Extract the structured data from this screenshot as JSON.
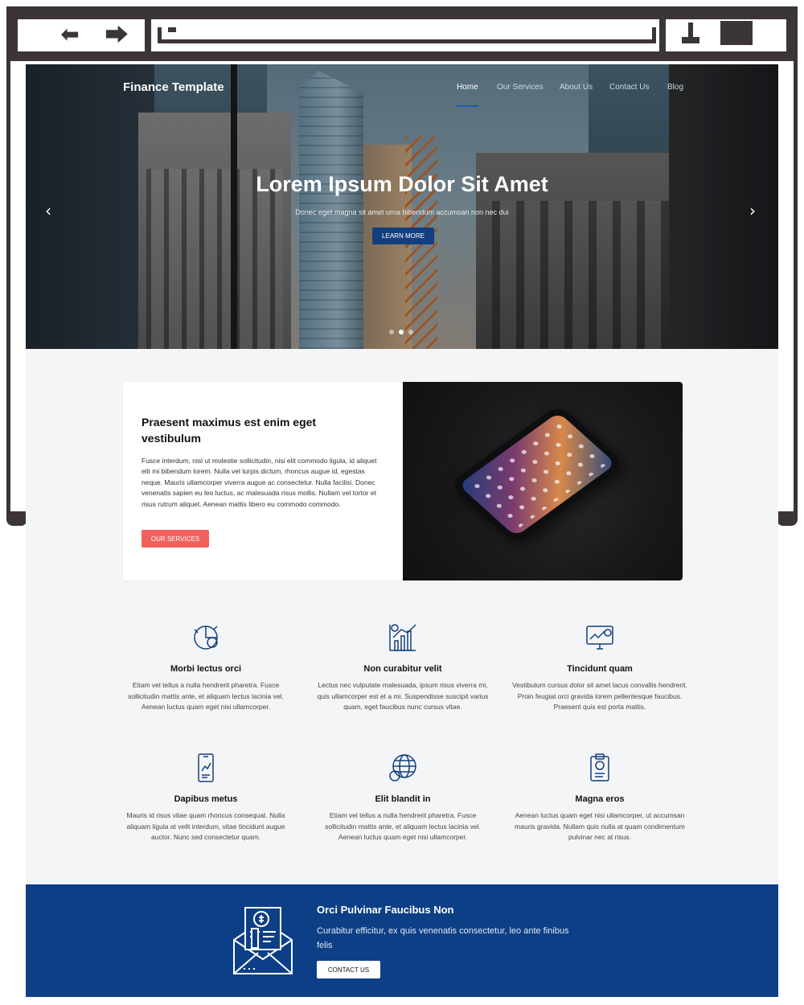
{
  "site": {
    "brand": "Finance Template",
    "nav": [
      {
        "label": "Home",
        "active": true
      },
      {
        "label": "Our Services",
        "active": false
      },
      {
        "label": "About Us",
        "active": false
      },
      {
        "label": "Contact Us",
        "active": false
      },
      {
        "label": "Blog",
        "active": false
      }
    ]
  },
  "hero": {
    "title": "Lorem Ipsum Dolor Sit Amet",
    "subtitle": "Donec eget magna sit amet urna bibendum accumsan non nec dui",
    "button": "LEARN MORE",
    "prev_icon": "chevron-left-icon",
    "next_icon": "chevron-right-icon",
    "slides": 3,
    "active_slide": 1
  },
  "about": {
    "title": "Praesent maximus est enim eget vestibulum",
    "text": "Fusce interdum, nisl ut molestie sollicitudin, nisi elit commodo ligula, id aliquet elit mi bibendum lorem. Nulla vel turpis dictum, rhoncus augue id, egestas neque. Mauris ullamcorper viverra augue ac consectetur. Nulla facilisi. Donec venenatis sapien eu leo luctus, ac malesuada risus mollis. Nullam vel tortor et risus rutrum aliquet. Aenean mattis libero eu commodo commodo.",
    "button": "OUR SERVICES"
  },
  "features": [
    {
      "icon": "pie-chart-dollar-icon",
      "title": "Morbi lectus orci",
      "text": "Etiam vel tellus a nulla hendrerit pharetra. Fusce sollicitudin mattis ante, et aliquam lectus lacinia vel. Aenean luctus quam eget nisi ullamcorper."
    },
    {
      "icon": "growth-chart-icon",
      "title": "Non curabitur velit",
      "text": "Lectus nec vulputate malesuada, ipsum risus viverra mi, quis ullamcorper est et a mi. Suspendisse suscipit varius quam, eget faucibus nunc cursus vitae."
    },
    {
      "icon": "monitor-analytics-icon",
      "title": "Tincidunt quam",
      "text": "Vestibulum cursus dolor sit amet lacus convallis hendrerit. Proin feugiat orci gravida lorem pellentesque faucibus. Praesent quis est porta mattis."
    },
    {
      "icon": "mobile-chart-icon",
      "title": "Dapibus metus",
      "text": "Mauris id risus vitae quam rhoncus consequat. Nulla aliquam ligula at velit interdum, vitae tincidunt augue auctor. Nunc sed consectetur quam."
    },
    {
      "icon": "globe-coins-icon",
      "title": "Elit blandit in",
      "text": "Etiam vel tellus a nulla hendrerit pharetra. Fusce sollicitudin mattis ante, et aliquam lectus lacinia vel. Aenean luctus quam eget nisi ullamcorper."
    },
    {
      "icon": "clipboard-dollar-icon",
      "title": "Magna eros",
      "text": "Aenean luctus quam eget nisi ullamcorper, ut accumsan mauris gravida. Nullam quis nulla at quam condimentum pulvinar nec at risus."
    }
  ],
  "cta": {
    "icon": "invoice-envelope-icon",
    "title": "Orci Pulvinar Faucibus Non",
    "text": "Curabitur efficitur, ex quis venenatis consectetur, leo ante finibus felis",
    "button": "CONTACT US"
  },
  "colors": {
    "primary": "#123f7f",
    "cta_bg": "#0d3f86",
    "accent": "#f0615e",
    "frame": "#3b3536",
    "page_bg": "#f4f5f7"
  },
  "browser": {
    "back_icon": "arrow-left-icon",
    "forward_icon": "arrow-right-icon",
    "minimize_icon": "minimize-icon",
    "maximize_icon": "maximize-icon"
  }
}
